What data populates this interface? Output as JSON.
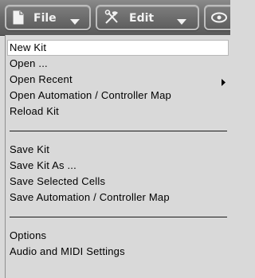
{
  "toolbar": {
    "file_label": "File",
    "edit_label": "Edit"
  },
  "menu": {
    "items": [
      {
        "label": "New Kit"
      },
      {
        "label": "Open ..."
      },
      {
        "label": "Open Recent"
      },
      {
        "label": "Open Automation / Controller Map"
      },
      {
        "label": "Reload Kit"
      },
      {
        "label": "Save Kit"
      },
      {
        "label": "Save Kit As ..."
      },
      {
        "label": "Save Selected Cells"
      },
      {
        "label": "Save Automation / Controller Map"
      },
      {
        "label": "Options"
      },
      {
        "label": "Audio and MIDI Settings"
      }
    ]
  },
  "icons": [
    "document-icon",
    "chevron-down-icon",
    "tools-icon",
    "eye-icon",
    "submenu-arrow-icon"
  ],
  "colors": {
    "menu_bg": "#d9d9d9",
    "highlight_bg": "#ffffff",
    "toolbar_bg": "#6a6a6a",
    "toolbar_text": "#f2f2f2"
  }
}
